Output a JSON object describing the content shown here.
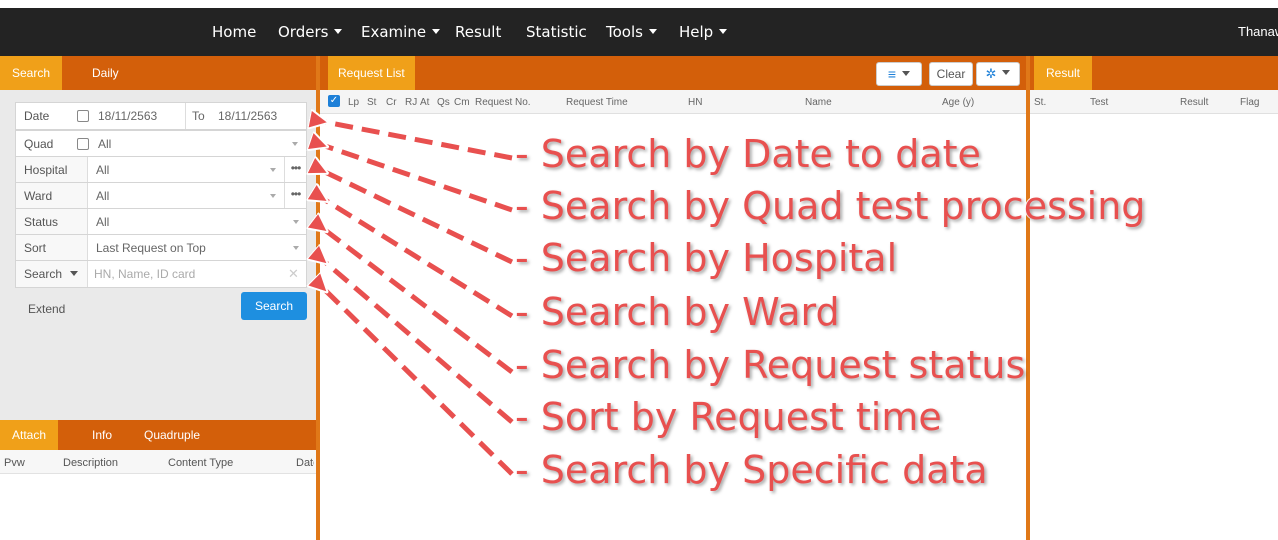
{
  "nav": {
    "items": [
      "Home",
      "Orders",
      "Examine",
      "Result",
      "Statistic",
      "Tools",
      "Help"
    ],
    "dropdown": [
      false,
      true,
      true,
      false,
      false,
      true,
      true
    ],
    "user": "Thanawa"
  },
  "left_tabs": {
    "search": "Search",
    "daily": "Daily"
  },
  "filters": {
    "date_label": "Date",
    "date_from": "18/11/2563",
    "to_label": "To",
    "date_to": "18/11/2563",
    "quad_label": "Quad",
    "quad_value": "All",
    "hospital_label": "Hospital",
    "hospital_value": "All",
    "ward_label": "Ward",
    "ward_value": "All",
    "status_label": "Status",
    "status_value": "All",
    "sort_label": "Sort",
    "sort_value": "Last Request on Top",
    "search_label": "Search",
    "search_placeholder": "HN, Name, ID card",
    "more_glyph": "•••",
    "clear_glyph": "✕"
  },
  "extend_label": "Extend",
  "search_button": "Search",
  "attach": {
    "tabs": [
      "Attach",
      "Info",
      "Quadruple"
    ],
    "columns": [
      "Pvw",
      "Description",
      "Content Type",
      "Date"
    ]
  },
  "request": {
    "tab": "Request List",
    "clear_button": "Clear",
    "columns": [
      "Lp",
      "St",
      "Cr",
      "RJ",
      "At",
      "Qs",
      "Cm",
      "Request No.",
      "Request Time",
      "HN",
      "Name",
      "Age (y)"
    ]
  },
  "result": {
    "tab": "Result",
    "columns": [
      "St.",
      "Test",
      "Result",
      "Flag"
    ]
  },
  "annotations": [
    "- Search by Date to date",
    "- Search by Quad test processing",
    "- Search by Hospital",
    "- Search by Ward",
    "- Search by Request status",
    "- Sort by Request time",
    "- Search by Specific data"
  ],
  "colors": {
    "orange": "#d35f0a",
    "orange_active": "#f0a019",
    "annotation": "#e8504f",
    "nav_bg": "#232323",
    "primary": "#1e8fe0"
  }
}
